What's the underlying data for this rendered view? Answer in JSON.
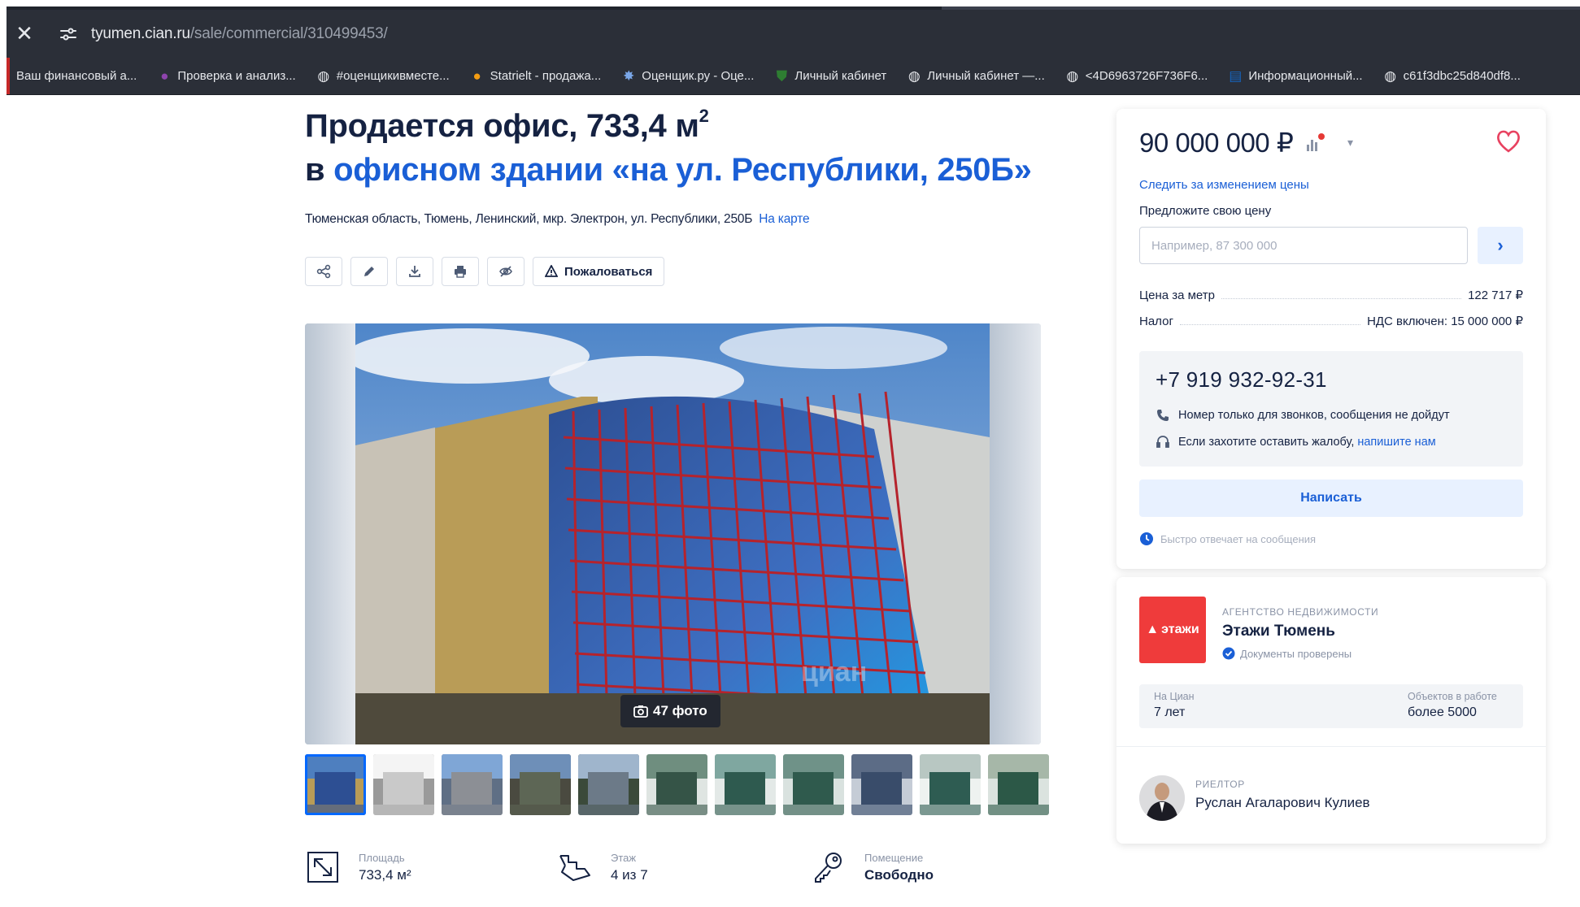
{
  "browser": {
    "url_host": "tyumen.cian.ru",
    "url_path": "/sale/commercial/310499453/",
    "close_glyph": "✕",
    "bookmarks": [
      {
        "label": "Ваш финансовый а...",
        "icon": "none"
      },
      {
        "label": "Проверка и анализ...",
        "icon": "purple-circle-icon"
      },
      {
        "label": "#оценщикивместе...",
        "icon": "globe-icon"
      },
      {
        "label": "Statrielt - продажа...",
        "icon": "colored-circle-icon"
      },
      {
        "label": "Оценщик.ру - Оце...",
        "icon": "star-icon"
      },
      {
        "label": "Личный кабинет",
        "icon": "shield-icon"
      },
      {
        "label": "Личный кабинет —...",
        "icon": "globe-icon"
      },
      {
        "label": "<4D6963726F736F6...",
        "icon": "globe-icon"
      },
      {
        "label": "Информационный...",
        "icon": "ris-icon"
      },
      {
        "label": "c61f3dbc25d840df8...",
        "icon": "globe-icon"
      }
    ]
  },
  "listing": {
    "title_prefix": "Продается офис, 733,4 м",
    "title_sup": "2",
    "subtitle_prefix": "в ",
    "subtitle_link": "офисном здании «на ул. Республики, 250Б»",
    "address": "Тюменская область, Тюмень, Ленинский, мкр. Электрон, ул. Республики, 250Б",
    "map_link": "На карте",
    "report_label": "Пожаловаться",
    "photo_count": "47 фото",
    "watermark": "циан",
    "features": [
      {
        "label": "Площадь",
        "value": "733,4 м²",
        "icon": "area-icon"
      },
      {
        "label": "Этаж",
        "value": "4 из 7",
        "icon": "stairs-icon"
      },
      {
        "label": "Помещение",
        "value": "Свободно",
        "icon": "key-icon"
      }
    ]
  },
  "price_card": {
    "price": "90 000 000 ₽",
    "follow_price": "Следить за изменением цены",
    "offer_label": "Предложите свою цену",
    "offer_placeholder": "Например, 87 300 000",
    "price_per_meter_label": "Цена за метр",
    "price_per_meter_value": "122 717 ₽",
    "tax_label": "Налог",
    "tax_value": "НДС включен: 15 000 000 ₽",
    "phone": "+7 919 932-92-31",
    "note_calls_only": "Номер только для звонков, сообщения не дойдут",
    "note_complaint": "Если захотите оставить жалобу,",
    "note_complaint_link": "напишите нам",
    "write_button": "Написать",
    "fast_reply": "Быстро отвечает на сообщения"
  },
  "agency": {
    "logo_text": "этажи",
    "type": "АГЕНТСТВО НЕДВИЖИМОСТИ",
    "name": "Этажи Тюмень",
    "verified": "Документы проверены",
    "stat1_label": "На Циан",
    "stat1_value": "7 лет",
    "stat2_label": "Объектов в работе",
    "stat2_value": "более 5000",
    "realtor_role": "РИЕЛТОР",
    "realtor_name": "Руслан Агаларович Кулиев"
  },
  "colors": {
    "accent": "#1a5fd6",
    "text": "#152242",
    "agency_red": "#ef3b3b",
    "favorite": "#e84260"
  }
}
